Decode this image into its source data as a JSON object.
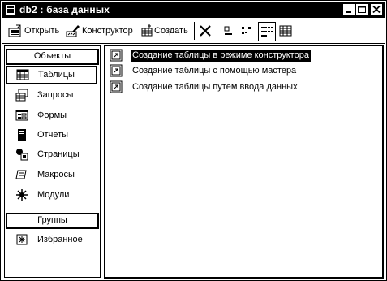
{
  "window": {
    "title": "db2 : база данных"
  },
  "toolbar": {
    "open_label": "Открыть",
    "design_label": "Конструктор",
    "create_label": "Создать"
  },
  "left_pane": {
    "objects_header": "Объекты",
    "objects": [
      {
        "label": "Таблицы",
        "icon": "table-icon",
        "selected": true
      },
      {
        "label": "Запросы",
        "icon": "query-icon"
      },
      {
        "label": "Формы",
        "icon": "form-icon"
      },
      {
        "label": "Отчеты",
        "icon": "report-icon"
      },
      {
        "label": "Страницы",
        "icon": "page-icon"
      },
      {
        "label": "Макросы",
        "icon": "macro-icon"
      },
      {
        "label": "Модули",
        "icon": "module-icon"
      }
    ],
    "groups_header": "Группы",
    "groups": [
      {
        "label": "Избранное",
        "icon": "favorites-icon"
      }
    ]
  },
  "right_pane": {
    "items": [
      {
        "label": "Создание таблицы в режиме конструктора",
        "selected": true
      },
      {
        "label": "Создание таблицы с помощью мастера"
      },
      {
        "label": "Создание таблицы путем ввода данных"
      }
    ]
  }
}
